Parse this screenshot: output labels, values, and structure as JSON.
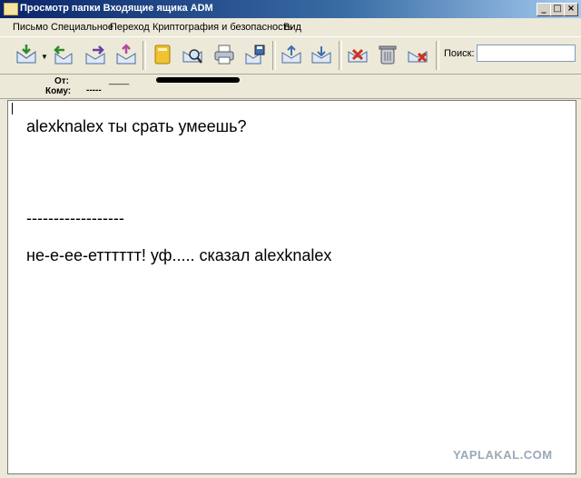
{
  "window": {
    "title": "Просмотр папки Входящие ящика ADM",
    "minimize": "_",
    "maximize": "□",
    "close": "×"
  },
  "menu": [
    "Письмо",
    "Специальное",
    "Переход",
    "Криптография и безопасность",
    "Вид"
  ],
  "toolbar": {
    "icons": [
      "get-mail-icon",
      "reply-icon",
      "forward-icon",
      "send-icon",
      "address-book-icon",
      "search-mail-icon",
      "print-icon",
      "save-icon",
      "prev-message-icon",
      "next-message-icon",
      "delete-icon",
      "trash-icon",
      "junk-icon"
    ],
    "search_label": "Поиск:",
    "search_value": ""
  },
  "header": {
    "from_label": "От:",
    "from_value": "____",
    "to_label": "Кому:",
    "to_value": "-----"
  },
  "message": {
    "line1": "alexknalex ты срать умеешь?",
    "divider": "------------------",
    "line2": "не-е-ее-етттттт! уф..... сказал alexknalex"
  },
  "watermark": "YAPLAKAL.COM"
}
